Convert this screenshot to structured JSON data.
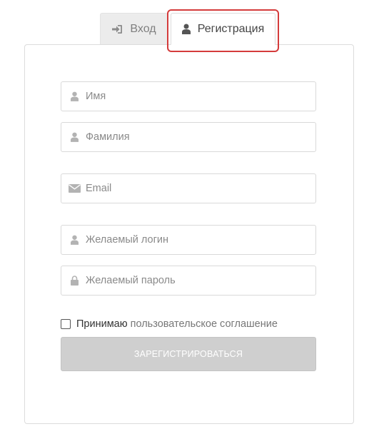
{
  "tabs": {
    "login": {
      "label": "Вход",
      "icon": "sign-in-icon"
    },
    "register": {
      "label": "Регистрация",
      "icon": "user-icon",
      "active": true
    }
  },
  "form": {
    "first_name": {
      "placeholder": "Имя",
      "value": "",
      "icon": "user-icon"
    },
    "last_name": {
      "placeholder": "Фамилия",
      "value": "",
      "icon": "user-icon"
    },
    "email": {
      "placeholder": "Email",
      "value": "",
      "icon": "envelope-icon"
    },
    "login": {
      "placeholder": "Желаемый логин",
      "value": "",
      "icon": "user-icon"
    },
    "password": {
      "placeholder": "Желаемый пароль",
      "value": "",
      "icon": "lock-icon"
    },
    "agreement": {
      "text": "Принимаю",
      "link": "пользовательское соглашение",
      "checked": false
    },
    "submit_label": "ЗАРЕГИСТРИРОВАТЬСЯ"
  },
  "colors": {
    "highlight": "#d43b3b",
    "button_disabled": "#cfcfcf",
    "icon": "#b3b3b3"
  }
}
